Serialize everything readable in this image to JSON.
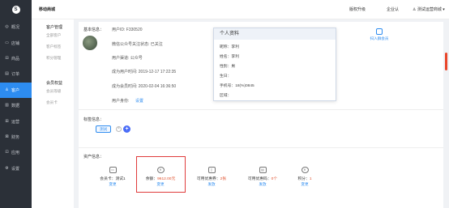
{
  "sidebar": {
    "logo": "S",
    "items": [
      {
        "label": "概况",
        "icon": "◎",
        "icon_name": "overview-icon"
      },
      {
        "label": "店铺",
        "icon": "▭",
        "icon_name": "store-icon"
      },
      {
        "label": "商品",
        "icon": "⊟",
        "icon_name": "goods-icon"
      },
      {
        "label": "订单",
        "icon": "▤",
        "icon_name": "order-icon"
      },
      {
        "label": "客户",
        "icon": "♙",
        "icon_name": "customer-icon"
      },
      {
        "label": "数据",
        "icon": "▥",
        "icon_name": "data-icon"
      },
      {
        "label": "运营",
        "icon": "⊞",
        "icon_name": "operation-icon"
      },
      {
        "label": "财务",
        "icon": "⊠",
        "icon_name": "finance-icon"
      },
      {
        "label": "应用",
        "icon": "⊡",
        "icon_name": "apps-icon"
      },
      {
        "label": "设置",
        "icon": "⚙",
        "icon_name": "gear-icon"
      }
    ],
    "active_index": 4
  },
  "subbar": {
    "title": "移动商城",
    "groups": [
      {
        "title": "客户管理",
        "items": [
          "全部客户",
          "客户标签",
          "积分管理"
        ]
      },
      {
        "title": "会员权益",
        "items": [
          "会员等级",
          "会员卡"
        ]
      }
    ]
  },
  "topbar": {
    "upgrade": "版权升级",
    "biz": "企业认",
    "user": "测试运营商城"
  },
  "basic": {
    "section_label": "基本信息：",
    "user_id": "用户ID: F330520",
    "wechat": "微信公众号关注状态: 已关注",
    "channel": "用户渠道: 公众号",
    "became_user": "成为用户时间: 2019-12-17 17:22:35",
    "became_member": "成为会员时间: 2020-02-04 16:36:50",
    "identity_label": "用户身份:",
    "identity_action": "设置"
  },
  "profile_card": {
    "title": "个人资料",
    "rows": [
      "昵称：李利",
      "姓名：李利",
      "性别：男",
      "生日：",
      "手机号：18(%)0845",
      "区域："
    ]
  },
  "promo": {
    "label": "扫入群会员"
  },
  "tags": {
    "section_label": "标签信息：",
    "tag": "测试"
  },
  "assets": {
    "section_label": "资产信息：",
    "items": [
      {
        "name": "membership-card",
        "text": "会员卡：测试1",
        "num": "",
        "action": "变更",
        "icon": "▭"
      },
      {
        "name": "balance",
        "text": "余额：",
        "num": "9612.00元",
        "action": "变更",
        "icon": "¥"
      },
      {
        "name": "coupons",
        "text": "可用优惠券：",
        "num": "2张",
        "action": "发放",
        "icon": "▯"
      },
      {
        "name": "gift-cards",
        "text": "可用优惠码：",
        "num": "0个",
        "action": "发放",
        "icon": "▤"
      },
      {
        "name": "points",
        "text": "积分：",
        "num": "1",
        "action": "变更",
        "icon": "¥"
      }
    ]
  }
}
